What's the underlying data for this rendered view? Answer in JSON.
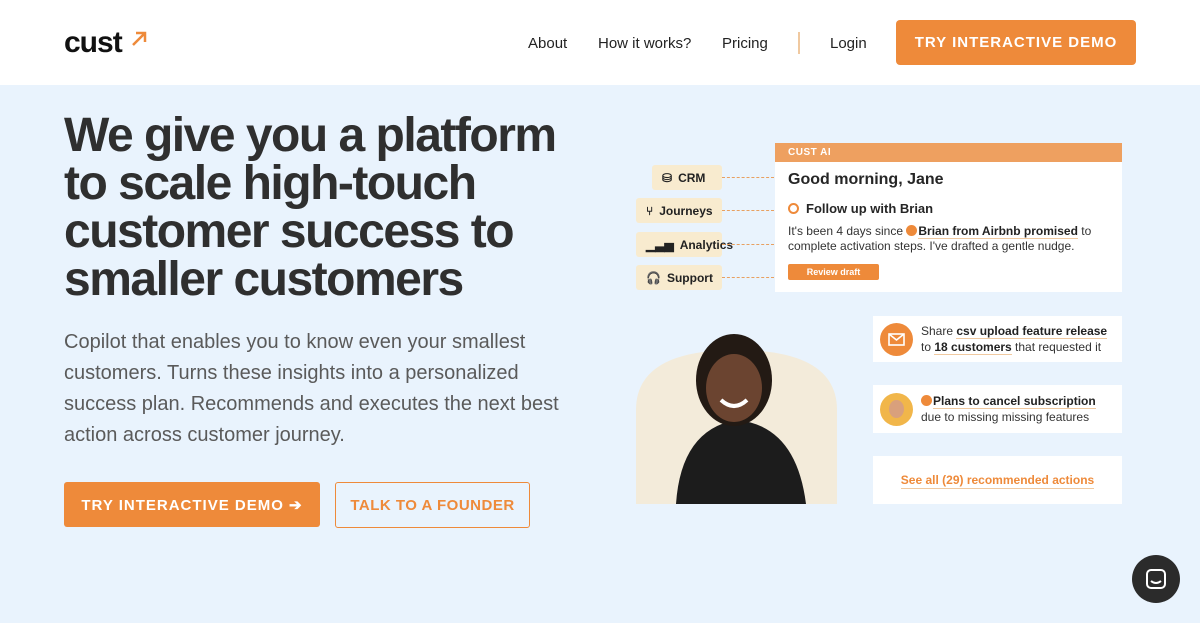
{
  "header": {
    "logo": "cust",
    "nav": [
      "About",
      "How it works?",
      "Pricing",
      "Login"
    ],
    "cta": "TRY INTERACTIVE DEMO"
  },
  "hero": {
    "title": "We give you a platform to scale high-touch customer success to smaller customers",
    "subtitle": "Copilot that enables you to know even your smallest customers. Turns these insights into a personalized success plan. Recommends and executes the next best action across customer journey.",
    "primary_cta": "TRY INTERACTIVE DEMO ➔",
    "secondary_cta": "TALK TO A FOUNDER"
  },
  "sources": [
    {
      "label": "CRM",
      "icon": "database-icon"
    },
    {
      "label": "Journeys",
      "icon": "branch-icon"
    },
    {
      "label": "Analytics",
      "icon": "bar-chart-icon"
    },
    {
      "label": "Support",
      "icon": "headset-icon"
    }
  ],
  "ai_card": {
    "header": "CUST AI",
    "greeting": "Good morning, Jane",
    "task": "Follow up with Brian",
    "msg_pre": "It's been 4 days since ",
    "msg_bold": "Brian from Airbnb promised",
    "msg_post": " to complete activation steps. I've drafted a gentle nudge.",
    "button": "Review draft"
  },
  "actions": {
    "a1_pre": "Share ",
    "a1_b1": "csv upload feature release",
    "a1_mid": " to ",
    "a1_b2": "18 customers",
    "a1_post": " that requested it",
    "a2_b": "Plans to cancel subscription",
    "a2_post": "due to missing missing features",
    "see_all": "See all (29) recommended actions"
  },
  "colors": {
    "accent": "#ee8a3a",
    "background": "#e9f3fd"
  }
}
